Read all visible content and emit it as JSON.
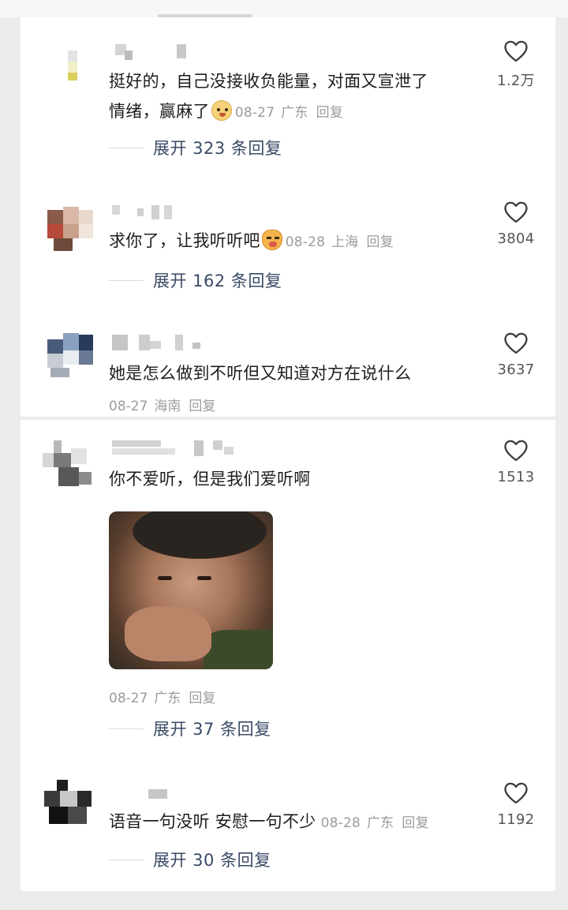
{
  "comments": [
    {
      "text_line1": "挺好的，自己没接收负能量，对面又宣泄了",
      "text_line2": "情绪，赢麻了",
      "date": "08-27",
      "location": "广东",
      "reply": "回复",
      "likes": "1.2万",
      "expand": "展开 323 条回复",
      "emoji": "smirk-dog-emoji"
    },
    {
      "text": "求你了，让我听听吧",
      "date": "08-28",
      "location": "上海",
      "reply": "回复",
      "likes": "3804",
      "expand": "展开 162 条回复",
      "emoji": "crying-cat-emoji"
    },
    {
      "text": "她是怎么做到不听但又知道对方在说什么",
      "date": "08-27",
      "location": "海南",
      "reply": "回复",
      "likes": "3637"
    },
    {
      "text": "你不爱听，但是我们爱听啊",
      "date": "08-27",
      "location": "广东",
      "reply": "回复",
      "likes": "1513",
      "expand": "展开 37 条回复",
      "image": "meme-photo"
    },
    {
      "text": "语音一句没听 安慰一句不少",
      "date": "08-28",
      "location": "广东",
      "reply": "回复",
      "likes": "1192",
      "expand": "展开 30 条回复"
    }
  ],
  "icons": {
    "like": "heart-outline-icon"
  },
  "colors": {
    "expand_text": "#3a4a66",
    "meta_text": "#9b9b9b",
    "body_text": "#1d1d1d"
  }
}
